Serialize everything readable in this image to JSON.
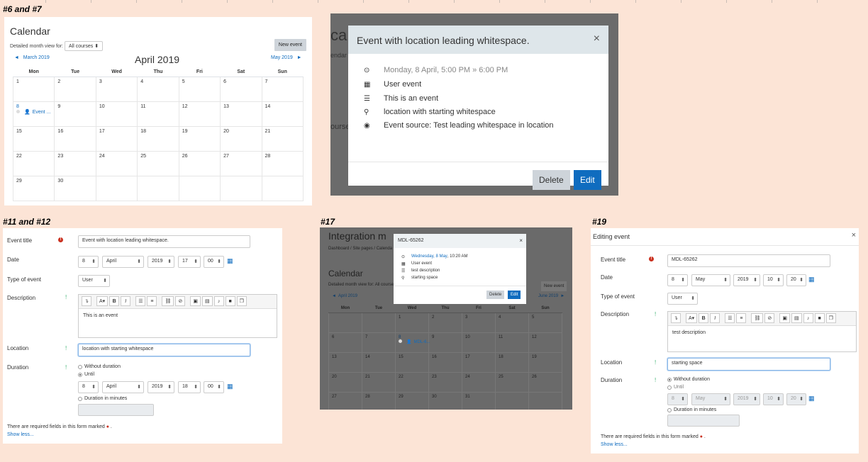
{
  "labels": {
    "s1": "#6 and #7",
    "s2": "#11 and #12",
    "s3": "#17",
    "s4": "#19"
  },
  "calendar": {
    "title": "Calendar",
    "view_label": "Detailed month view for:",
    "course_select": "All courses",
    "new_event": "New event",
    "prev": "March 2019",
    "month": "April 2019",
    "next": "May 2019",
    "weekdays": [
      "Mon",
      "Tue",
      "Wed",
      "Thu",
      "Fri",
      "Sat",
      "Sun"
    ],
    "event_label": "Event ...",
    "event_day": "8"
  },
  "modal": {
    "title": "Event with location leading whitespace.",
    "date": "Monday, 8 April, 5:00 PM » 6:00 PM",
    "type": "User event",
    "description": "This is an event",
    "location": "location with starting whitespace",
    "source": "Event source: Test leading whitespace in location",
    "delete": "Delete",
    "edit": "Edit",
    "bg_text1": "ca",
    "bg_text2": "endar",
    "bg_text3": "ourses"
  },
  "form1": {
    "event_title_label": "Event title",
    "event_title": "Event with location leading whitespace.",
    "date_label": "Date",
    "day": "8",
    "month": "April",
    "year": "2019",
    "hour": "17",
    "minute": "00",
    "type_label": "Type of event",
    "type": "User",
    "description_label": "Description",
    "description": "This is an event",
    "location_label": "Location",
    "location": "location with starting whitespace",
    "duration_label": "Duration",
    "without_duration": "Without duration",
    "until": "Until",
    "until_day": "8",
    "until_month": "April",
    "until_year": "2019",
    "until_hour": "18",
    "until_minute": "00",
    "duration_minutes": "Duration in minutes",
    "required_note": "There are required fields in this form marked",
    "show_less": "Show less..."
  },
  "p17": {
    "title_bg": "Integration m",
    "breadcrumb": "Dashboard  /  Site pages  /  Calenda",
    "calendar": "Calendar",
    "view_label": "Detailed month view for:",
    "course_select": "All courses",
    "new_event": "New event",
    "prev": "April 2019",
    "next": "June 2019",
    "weekdays": [
      "Mon",
      "Tue",
      "Wed",
      "Thu",
      "Fri",
      "Sat",
      "Sun"
    ],
    "event_label": "MDL-6...",
    "modal_title": "MDL-65262",
    "modal_date_link": "Wednesday, 8 May",
    "modal_time": ", 10:20 AM",
    "modal_type": "User event",
    "modal_desc": "test description",
    "modal_loc": "starting space",
    "delete": "Delete",
    "edit": "Edit"
  },
  "form2": {
    "heading": "Editing event",
    "event_title_label": "Event title",
    "event_title": "MDL-65262",
    "date_label": "Date",
    "day": "8",
    "month": "May",
    "year": "2019",
    "hour": "10",
    "minute": "20",
    "type_label": "Type of event",
    "type": "User",
    "description_label": "Description",
    "description": "test description",
    "location_label": "Location",
    "location": "starting space",
    "duration_label": "Duration",
    "without_duration": "Without duration",
    "until": "Until",
    "until_day": "8",
    "until_month": "May",
    "until_year": "2019",
    "until_hour": "10",
    "until_minute": "20",
    "duration_minutes": "Duration in minutes",
    "required_note": "There are required fields in this form marked",
    "show_less": "Show less..."
  },
  "colors": {
    "background": "#fce4d6",
    "link": "#0f6cbf",
    "required": "#ca3120",
    "help": "#3cb371"
  }
}
